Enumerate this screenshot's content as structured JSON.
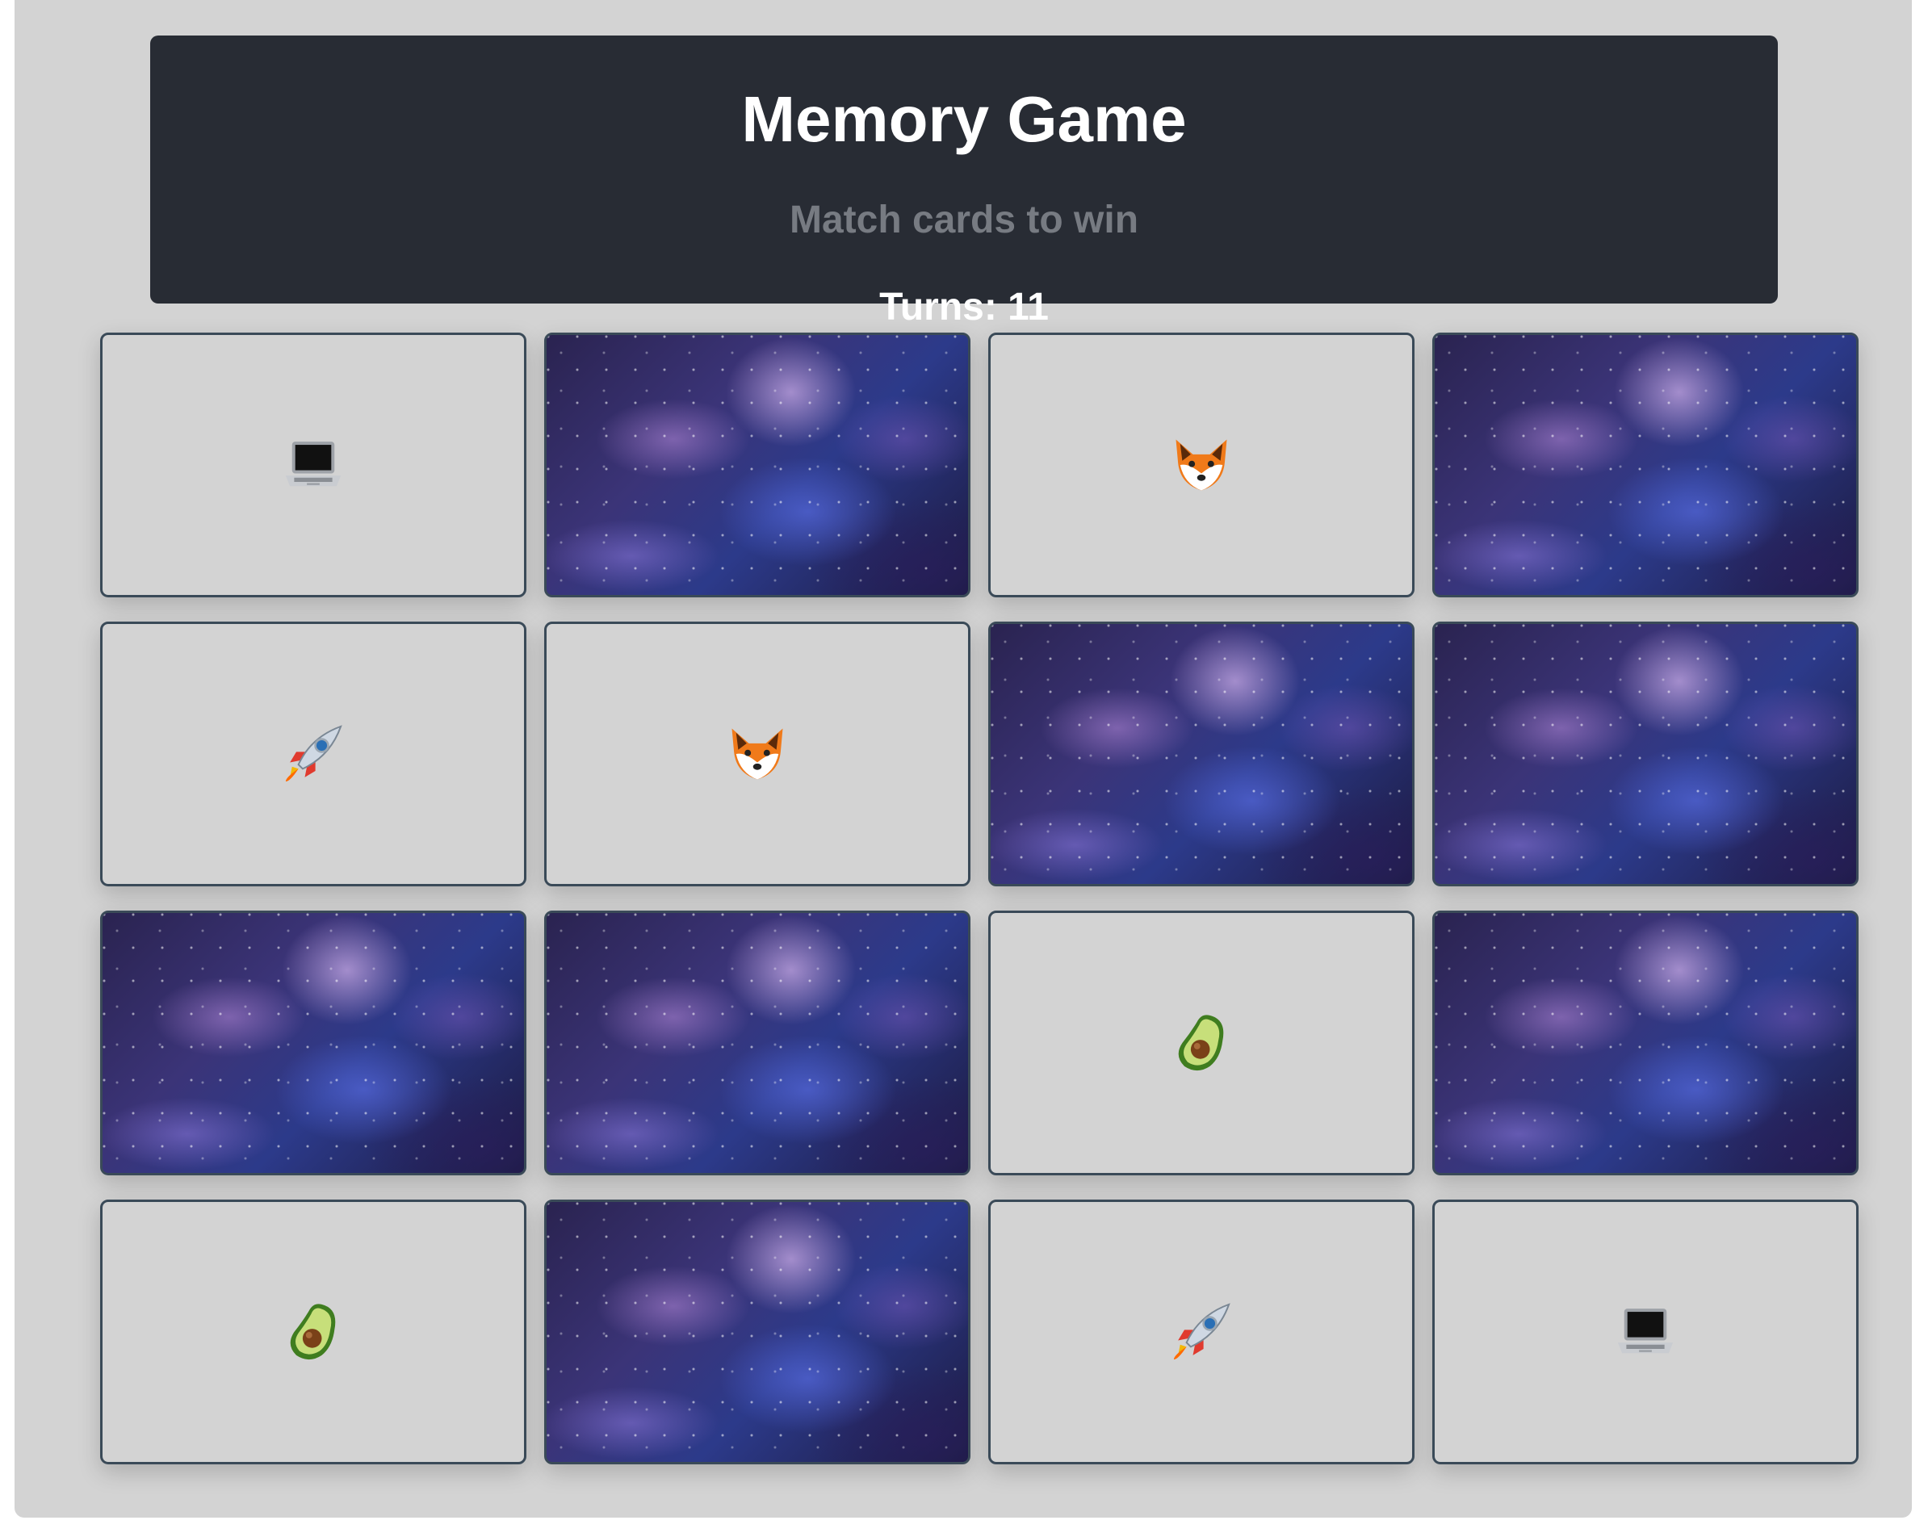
{
  "header": {
    "title": "Memory Game",
    "subtitle": "Match cards to win",
    "turns_label": "Turns: 11"
  },
  "colors": {
    "page_background": "#d3d3d3",
    "header_background": "#282c34",
    "header_text": "#ffffff",
    "subtitle_text": "#777b82",
    "card_border": "#3a4a58"
  },
  "board": {
    "rows": 4,
    "columns": 4,
    "cards": [
      {
        "state": "revealed",
        "symbol": "laptop-icon"
      },
      {
        "state": "hidden",
        "symbol": "galaxy-card-back"
      },
      {
        "state": "revealed",
        "symbol": "fox-icon"
      },
      {
        "state": "hidden",
        "symbol": "galaxy-card-back"
      },
      {
        "state": "revealed",
        "symbol": "rocket-icon"
      },
      {
        "state": "revealed",
        "symbol": "fox-icon"
      },
      {
        "state": "hidden",
        "symbol": "galaxy-card-back"
      },
      {
        "state": "hidden",
        "symbol": "galaxy-card-back"
      },
      {
        "state": "hidden",
        "symbol": "galaxy-card-back"
      },
      {
        "state": "hidden",
        "symbol": "galaxy-card-back"
      },
      {
        "state": "revealed",
        "symbol": "avocado-icon"
      },
      {
        "state": "hidden",
        "symbol": "galaxy-card-back"
      },
      {
        "state": "revealed",
        "symbol": "avocado-icon"
      },
      {
        "state": "hidden",
        "symbol": "galaxy-card-back"
      },
      {
        "state": "revealed",
        "symbol": "rocket-icon"
      },
      {
        "state": "revealed",
        "symbol": "laptop-icon"
      }
    ]
  }
}
